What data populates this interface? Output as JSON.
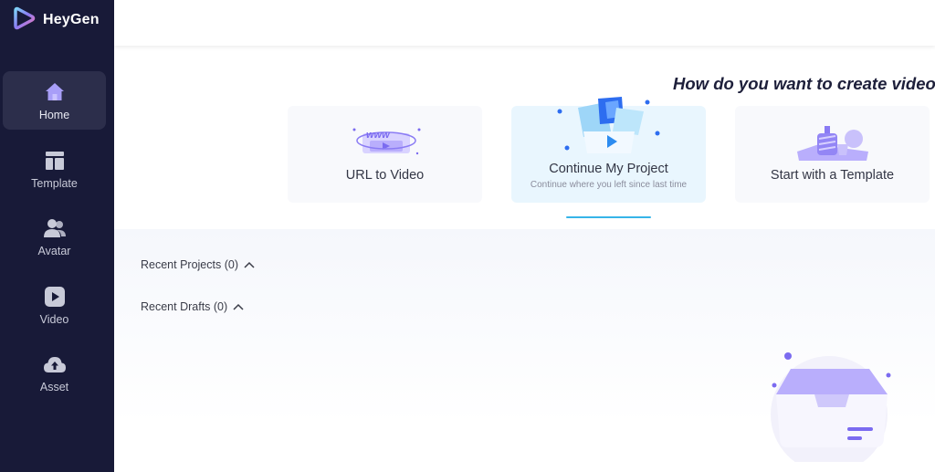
{
  "app": {
    "brand": "HeyGen"
  },
  "sidebar": {
    "items": [
      {
        "label": "Home",
        "icon": "home-icon",
        "active": true
      },
      {
        "label": "Template",
        "icon": "template-icon",
        "active": false
      },
      {
        "label": "Avatar",
        "icon": "avatar-icon",
        "active": false
      },
      {
        "label": "Video",
        "icon": "video-icon",
        "active": false
      },
      {
        "label": "Asset",
        "icon": "cloud-upload-icon",
        "active": false
      }
    ]
  },
  "main": {
    "headline": "How do you want to create videos",
    "cards": [
      {
        "title": "URL to Video",
        "subtitle": ""
      },
      {
        "title": "Continue My Project",
        "subtitle": "Continue where you left since last time"
      },
      {
        "title": "Start with a Template",
        "subtitle": ""
      }
    ],
    "recent_projects": "Recent Projects (0)",
    "recent_drafts": "Recent Drafts (0)",
    "url_art_text": "www"
  },
  "colors": {
    "sidebar_bg": "#181a38",
    "active_nav_bg": "#2c2e4b",
    "accent_purple": "#7b6bf0",
    "accent_blue": "#36b4e8"
  }
}
